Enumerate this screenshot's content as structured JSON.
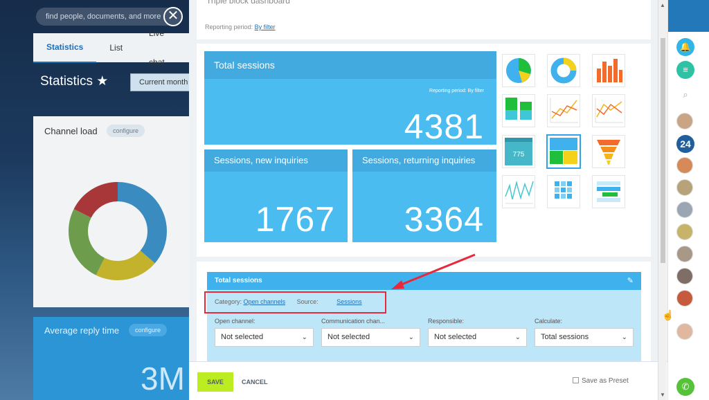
{
  "background": {
    "search_placeholder": "find people, documents, and more",
    "close_glyph": "✕",
    "tabs": [
      "Statistics",
      "List",
      "Live chat"
    ],
    "page_title": "Statistics ★",
    "period_button": "Current month",
    "channel_card": {
      "title": "Channel load",
      "configure": "configure"
    },
    "reply_card": {
      "title": "Average reply time",
      "configure": "configure",
      "value": "3M"
    }
  },
  "modal": {
    "header_title": "Triple block dashboard",
    "reporting_label": "Reporting period:",
    "reporting_link": "By filter",
    "tiles": {
      "total": {
        "title": "Total sessions",
        "subtitle": "Reporting period: By filter",
        "value": "4381"
      },
      "new": {
        "title": "Sessions, new inquiries",
        "value": "1767"
      },
      "returning": {
        "title": "Sessions, returning inquiries",
        "value": "3364"
      }
    },
    "widget_icons": [
      "pie-chart-icon",
      "donut-chart-icon",
      "bar-chart-icon",
      "stacked-bar-icon",
      "line-chart-icon",
      "line-chart-alt-icon",
      "number-tile-icon",
      "triple-block-icon",
      "funnel-icon",
      "sparkline-icon",
      "heatmap-icon",
      "table-chart-icon"
    ],
    "widget_thumb_value": "775",
    "settings": {
      "header": "Total sessions",
      "edit_glyph": "✎",
      "category_label": "Category:",
      "category_value": "Open channels",
      "source_label": "Source:",
      "source_value": "Sessions",
      "fields": [
        {
          "label": "Open channel:",
          "value": "Not selected"
        },
        {
          "label": "Communication chan...",
          "value": "Not selected"
        },
        {
          "label": "Responsible:",
          "value": "Not selected"
        },
        {
          "label": "Calculate:",
          "value": "Total sessions"
        }
      ]
    },
    "footer": {
      "save": "SAVE",
      "cancel": "CANCEL",
      "preset": "Save as Preset"
    }
  },
  "rightbar": {
    "messenger_badge": "24"
  },
  "colors": {
    "tile_blue": "#4bbcf0",
    "tile_head": "#43aadf",
    "save_green": "#bbed21",
    "annotation_red": "#e8283c",
    "accent_blue": "#2278b9"
  }
}
